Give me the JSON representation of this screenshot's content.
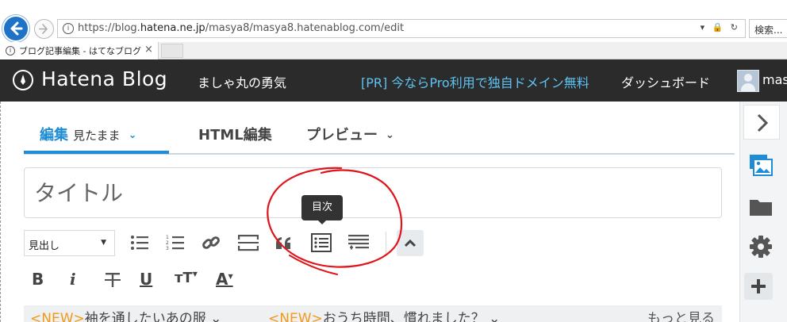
{
  "browser": {
    "url_prefix": "https://blog.",
    "url_domain": "hatena.ne.jp",
    "url_path": "/masya8/masya8.hatenablog.com/edit",
    "url_tools": "▾ 🔒 ↻",
    "search_placeholder": "検索...",
    "tab_title": "ブログ記事編集 - はてなブログ",
    "tab_close": "×"
  },
  "header": {
    "logo": "Hatena Blog",
    "blog_name": "ましゃ丸の勇気",
    "pr_link": "[PR] 今ならPro利用で独自ドメイン無料",
    "dashboard": "ダッシュボード",
    "user": "mas"
  },
  "editor": {
    "tabs": [
      {
        "label": "編集",
        "sub": "見たまま"
      },
      {
        "label": "HTML編集"
      },
      {
        "label": "プレビュー"
      }
    ],
    "title_placeholder": "タイトル",
    "heading_select": "見出し",
    "tooltip": "目次",
    "format": {
      "bold": "B",
      "italic": "i",
      "underline": "U",
      "size": "тT",
      "color": "A"
    },
    "news": [
      {
        "tag": "<NEW>",
        "text": "袖を通したいあの服 ⌄"
      },
      {
        "tag": "<NEW>",
        "text": "おうち時間、慣れました？ ⌄"
      }
    ],
    "more": "もっと見る"
  },
  "colors": {
    "accent": "#1f8dd6",
    "header_bg": "#2b2b2b",
    "pr_link": "#5ec3f4",
    "news_tag": "#f09a1a",
    "annotation": "#e0141a"
  }
}
